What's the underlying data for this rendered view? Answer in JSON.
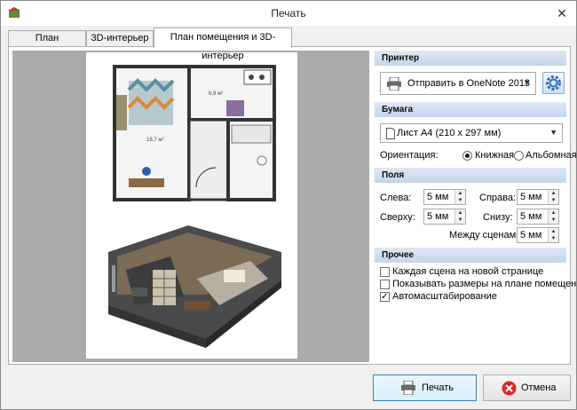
{
  "window": {
    "title": "Печать"
  },
  "tabs": [
    {
      "label": "План помещения"
    },
    {
      "label": "3D-интерьер"
    },
    {
      "label": "План помещения и 3D-интерьер"
    }
  ],
  "printer": {
    "section_label": "Принтер",
    "selected": "Отправить в OneNote 2013"
  },
  "paper": {
    "section_label": "Бумага",
    "selected": "Лист A4 (210 x 297 мм)",
    "orientation_label": "Ориентация:",
    "portrait_label": "Книжная",
    "landscape_label": "Альбомная",
    "orientation_selected": "portrait"
  },
  "margins": {
    "section_label": "Поля",
    "left_label": "Слева:",
    "left_value": "5 мм",
    "right_label": "Справа:",
    "right_value": "5 мм",
    "top_label": "Сверху:",
    "top_value": "5 мм",
    "bottom_label": "Снизу:",
    "bottom_value": "5 мм",
    "between_label": "Между сценами:",
    "between_value": "5 мм"
  },
  "other": {
    "section_label": "Прочее",
    "options": [
      {
        "label": "Каждая сцена на новой странице",
        "checked": false
      },
      {
        "label": "Показывать размеры на плане помещения",
        "checked": false
      },
      {
        "label": "Автомасштабирование",
        "checked": true
      }
    ]
  },
  "plan_labels": {
    "room1": "6,9 м²",
    "room2": "18,7 м²"
  },
  "buttons": {
    "print": "Печать",
    "cancel": "Отмена"
  },
  "colors": {
    "accent": "#2f6fb5",
    "cancel_red": "#d9262c",
    "header_bg": "#c9d9ec"
  }
}
